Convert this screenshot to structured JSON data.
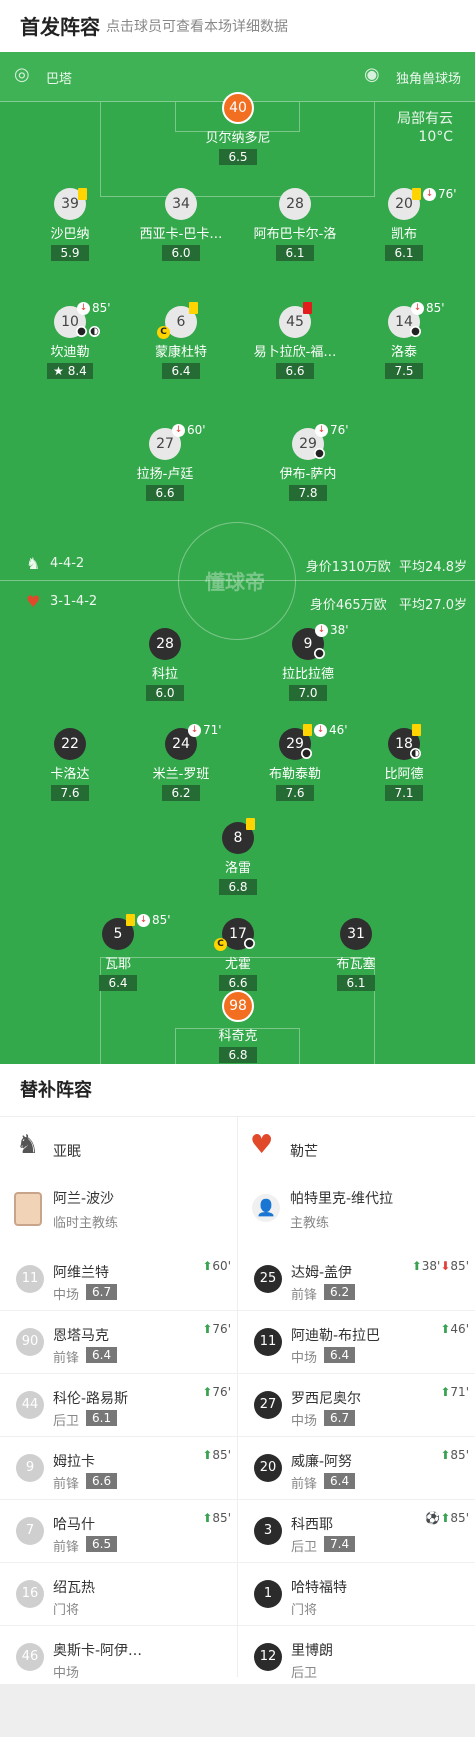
{
  "header": {
    "title": "首发阵容",
    "subtitle": "点击球员可查看本场详细数据"
  },
  "pitch": {
    "home_team": "巴塔",
    "venue": "独角兽球场",
    "weather": "局部有云",
    "temp": "10°C",
    "logo": "懂球帝"
  },
  "home": {
    "formation": "4-4-2",
    "value": "身价1310万欧",
    "age": "平均24.8岁"
  },
  "away": {
    "formation": "3-1-4-2",
    "value": "身价465万欧",
    "age": "平均27.0岁"
  },
  "players": [
    {
      "num": "40",
      "name": "贝尔纳多尼",
      "rating": "6.5"
    },
    {
      "num": "39",
      "name": "沙巴纳",
      "rating": "5.9"
    },
    {
      "num": "34",
      "name": "西亚卡-巴卡…",
      "rating": "6.0"
    },
    {
      "num": "28",
      "name": "阿布巴卡尔-洛",
      "rating": "6.1"
    },
    {
      "num": "20",
      "name": "凯布",
      "rating": "6.1",
      "min": "76'"
    },
    {
      "num": "10",
      "name": "坎迪勒",
      "rating": "8.4",
      "min": "85'"
    },
    {
      "num": "6",
      "name": "蒙康杜特",
      "rating": "6.4"
    },
    {
      "num": "45",
      "name": "易卜拉欣-福…",
      "rating": "6.6"
    },
    {
      "num": "14",
      "name": "洛泰",
      "rating": "7.5",
      "min": "85'"
    },
    {
      "num": "27",
      "name": "拉扬-卢廷",
      "rating": "6.6",
      "min": "60'"
    },
    {
      "num": "29",
      "name": "伊布-萨内",
      "rating": "7.8",
      "min": "76'"
    },
    {
      "num": "28",
      "name": "科拉",
      "rating": "6.0"
    },
    {
      "num": "9",
      "name": "拉比拉德",
      "rating": "7.0",
      "min": "38'"
    },
    {
      "num": "22",
      "name": "卡洛达",
      "rating": "7.6"
    },
    {
      "num": "24",
      "name": "米兰-罗班",
      "rating": "6.2",
      "min": "71'"
    },
    {
      "num": "29",
      "name": "布勒泰勒",
      "rating": "7.6",
      "min": "46'"
    },
    {
      "num": "18",
      "name": "比阿德",
      "rating": "7.1"
    },
    {
      "num": "8",
      "name": "洛雷",
      "rating": "6.8"
    },
    {
      "num": "5",
      "name": "瓦耶",
      "rating": "6.4",
      "min": "85'"
    },
    {
      "num": "17",
      "name": "尤霍",
      "rating": "6.6"
    },
    {
      "num": "31",
      "name": "布瓦塞",
      "rating": "6.1"
    },
    {
      "num": "98",
      "name": "科奇克",
      "rating": "6.8"
    }
  ],
  "subs": {
    "title": "替补阵容",
    "left_team": "亚眠",
    "right_team": "勒芒",
    "left_coach": {
      "name": "阿兰-波沙",
      "role": "临时主教练"
    },
    "right_coach": {
      "name": "帕特里克-维代拉",
      "role": "主教练"
    },
    "left": [
      {
        "num": "11",
        "name": "阿维兰特",
        "pos": "中场",
        "rating": "6.7",
        "ev": "60'"
      },
      {
        "num": "90",
        "name": "恩塔马克",
        "pos": "前锋",
        "rating": "6.4",
        "ev": "76'"
      },
      {
        "num": "44",
        "name": "科伦-路易斯",
        "pos": "后卫",
        "rating": "6.1",
        "ev": "76'"
      },
      {
        "num": "9",
        "name": "姆拉卡",
        "pos": "前锋",
        "rating": "6.6",
        "ev": "85'"
      },
      {
        "num": "7",
        "name": "哈马什",
        "pos": "前锋",
        "rating": "6.5",
        "ev": "85'"
      },
      {
        "num": "16",
        "name": "绍瓦热",
        "pos": "门将"
      },
      {
        "num": "46",
        "name": "奥斯卡-阿伊…",
        "pos": "中场"
      }
    ],
    "right": [
      {
        "num": "25",
        "name": "达姆-盖伊",
        "pos": "前锋",
        "rating": "6.2",
        "ev": "38'",
        "ev2": "85'"
      },
      {
        "num": "11",
        "name": "阿迪勒-布拉巴",
        "pos": "中场",
        "rating": "6.4",
        "ev": "46'"
      },
      {
        "num": "27",
        "name": "罗西尼奥尔",
        "pos": "中场",
        "rating": "6.7",
        "ev": "71'"
      },
      {
        "num": "20",
        "name": "威廉-阿努",
        "pos": "前锋",
        "rating": "6.4",
        "ev": "85'"
      },
      {
        "num": "3",
        "name": "科西耶",
        "pos": "后卫",
        "rating": "7.4",
        "ev": "85'"
      },
      {
        "num": "1",
        "name": "哈特福特",
        "pos": "门将"
      },
      {
        "num": "12",
        "name": "里博朗",
        "pos": "后卫"
      }
    ]
  },
  "colors": {
    "pitch": "#34a94b",
    "gk": "#f26f21",
    "card": "#ffd400"
  }
}
